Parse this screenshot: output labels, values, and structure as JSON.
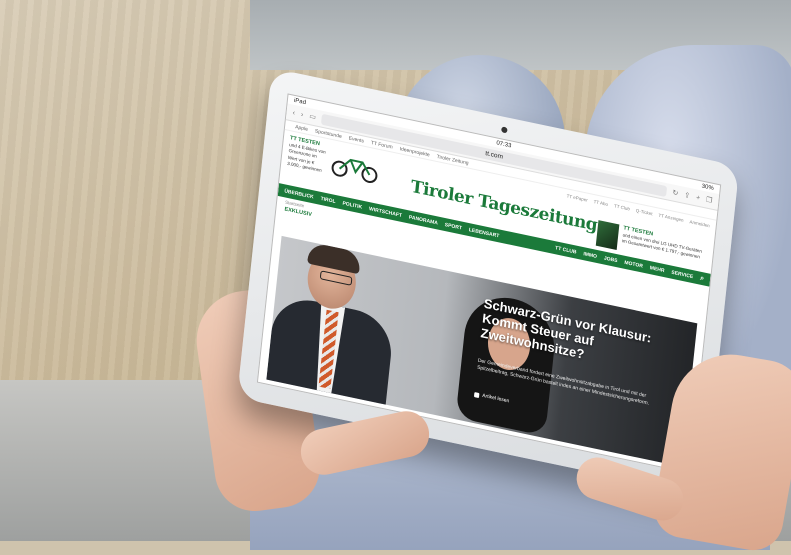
{
  "browser": {
    "status_left": "iPad",
    "status_time": "07:33",
    "status_right": "30%",
    "url": "tt.com",
    "bookmarks": [
      "Apple",
      "Sportstunde",
      "Events",
      "TT Forum",
      "Ideenprojekte",
      "Tiroler Zeitung"
    ]
  },
  "header": {
    "logo": "Tiroler Tageszeitung",
    "ad_left": {
      "title": "TT TESTEN",
      "text": "und 4 E-Bikes von Greenzone im Wert von je € 3.000,- gewinnen"
    },
    "ad_left_brand": "GREENZONE",
    "top_links": [
      "TT ePaper",
      "TT Abo",
      "TT Club",
      "Q-Ticket",
      "TT Anzeigen",
      "Anmelden"
    ],
    "ad_right": {
      "title": "TT TESTEN",
      "text": "und einen von drei LG UHD TV-Geräten im Gesamtwert von € 1.797,- gewinnen"
    }
  },
  "nav": {
    "items": [
      "ÜBERBLICK",
      "TIROL",
      "POLITIK",
      "WIRTSCHAFT",
      "PANORAMA",
      "SPORT",
      "LEBENSART"
    ],
    "right_items": [
      "TT CLUB",
      "IMMO",
      "JOBS",
      "MOTOR",
      "MEHR",
      "SERVICE"
    ]
  },
  "breadcrumb": "Startseite",
  "exklusiv": "EXKLUSIV",
  "hero": {
    "headline": "Schwarz-Grün vor Klausur: Kommt Steuer auf Zweitwohnsitze?",
    "teaser": "Der Gemeindeverband fordert eine Zweitwohnsitzabgabe in Tirol und mit der Spitzelbeitrag, Schwarz-Grün bastelt indes an einer Mindestsicherungsreform.",
    "tag": "Artikel lesen"
  }
}
